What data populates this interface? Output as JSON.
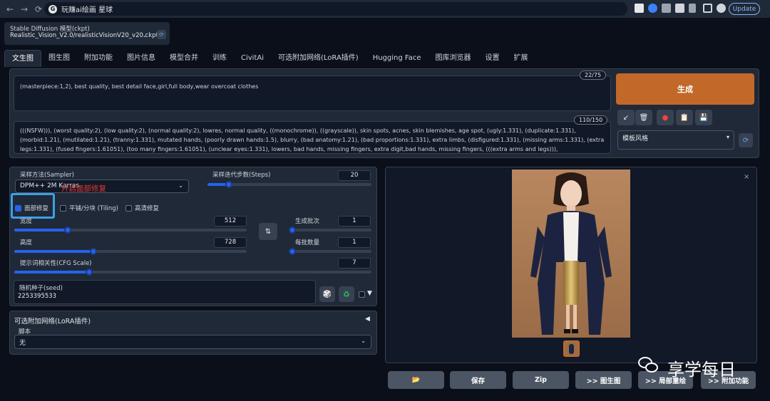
{
  "browser": {
    "tab_title": "玩赚ai绘画 星球",
    "update_label": "Update"
  },
  "model": {
    "label": "Stable Diffusion 模型(ckpt)",
    "value": "Realistic_Vision_V2.0/realisticVisionV20_v20.ckpt"
  },
  "tabs": [
    "文生图",
    "图生图",
    "附加功能",
    "图片信息",
    "模型合并",
    "训练",
    "CivitAi",
    "可选附加网络(LoRA插件)",
    "Hugging Face",
    "图库浏览器",
    "设置",
    "扩展"
  ],
  "prompt": {
    "text": "(masterpiece:1,2), best quality, best detail face,girl,full body,wear overcoat clothes",
    "counter": "22/75"
  },
  "negative": {
    "text": "(((NSFW))), (worst quality:2), (low quality:2), (normal quality:2), lowres, normal quality, ((monochrome)), ((grayscale)), skin spots, acnes, skin blemishes, age spot, (ugly:1.331), (duplicate:1.331), (morbid:1.21), (mutilated:1.21), (tranny:1.331), mutated hands, (poorly drawn hands:1.5), blurry, (bad anatomy:1.21), (bad proportions:1.331), extra limbs, (disfigured:1.331), (missing arms:1.331), (extra legs:1.331), (fused fingers:1.61051), (too many fingers:1.61051), (unclear eyes:1.331), lowers, bad hands, missing fingers, extra digit,bad hands, missing fingers, (((extra arms and legs))),",
    "counter": "110/150"
  },
  "generate_label": "生成",
  "style": {
    "label": "模板风格"
  },
  "sampler": {
    "label": "采样方法(Sampler)",
    "value": "DPM++ 2M Karras",
    "annotation": "开启面部修复"
  },
  "steps": {
    "label": "采样迭代步数(Steps)",
    "value": "20",
    "fraction": 0.13
  },
  "checks": {
    "face": "面部修复",
    "tiling": "平铺/分块 (Tiling)",
    "hires": "高清修复"
  },
  "width": {
    "label": "宽度",
    "value": "512",
    "fraction": 0.23
  },
  "height": {
    "label": "高度",
    "value": "728",
    "fraction": 0.34
  },
  "batch_count": {
    "label": "生成批次",
    "value": "1",
    "fraction": 0.0
  },
  "batch_size": {
    "label": "每批数量",
    "value": "1",
    "fraction": 0.0
  },
  "cfg": {
    "label": "提示词相关性(CFG Scale)",
    "value": "7",
    "fraction": 0.21
  },
  "seed": {
    "label": "随机种子(seed)",
    "value": "2253395533"
  },
  "lora": {
    "label": "可选附加网络(LoRA插件)"
  },
  "script": {
    "label": "脚本",
    "value": "无"
  },
  "actions": {
    "save": "保存",
    "zip": "Zip",
    "to_img2img": ">> 图生图",
    "to_inpaint": ">> 局部重绘",
    "to_extras": ">> 附加功能"
  },
  "watermark": "享学每日",
  "colors": {
    "accent": "#c2692a",
    "highlight": "#3ba0e6",
    "annotation": "#e53935"
  }
}
